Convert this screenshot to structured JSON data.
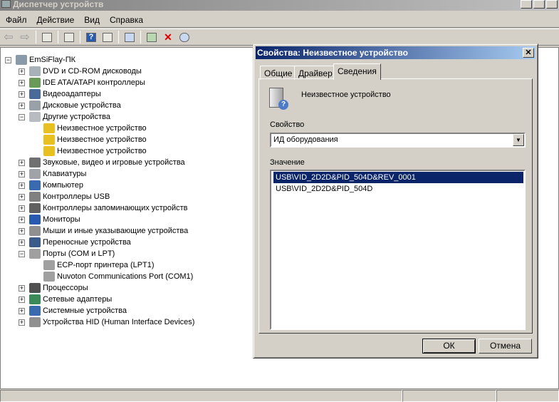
{
  "window": {
    "title": "Диспетчер устройств",
    "min": "_",
    "max": "□",
    "close": "✕"
  },
  "menu": [
    "Файл",
    "Действие",
    "Вид",
    "Справка"
  ],
  "toolbar": [
    "back",
    "forward",
    "show-hide",
    "properties",
    "help",
    "action-pane",
    "scan",
    "update-driver",
    "uninstall",
    "disable"
  ],
  "tree": [
    {
      "level": 0,
      "label": "EmSiFlay-ПК",
      "exp": "−",
      "icon": "computer-icon",
      "color": "#8a9aa8"
    },
    {
      "level": 1,
      "label": "DVD и CD-ROM дисководы",
      "exp": "+",
      "icon": "dvd-icon",
      "color": "#a8b0b8"
    },
    {
      "level": 1,
      "label": "IDE ATA/ATAPI контроллеры",
      "exp": "+",
      "icon": "ide-icon",
      "color": "#6a9a5a"
    },
    {
      "level": 1,
      "label": "Видеоадаптеры",
      "exp": "+",
      "icon": "display-adapter-icon",
      "color": "#4a6a9a"
    },
    {
      "level": 1,
      "label": "Дисковые устройства",
      "exp": "+",
      "icon": "disk-icon",
      "color": "#9aa0a8"
    },
    {
      "level": 1,
      "label": "Другие устройства",
      "exp": "−",
      "icon": "unknown-device-icon",
      "color": "#b8bcc0"
    },
    {
      "level": 2,
      "label": "Неизвестное устройство",
      "icon": "warning-device-icon",
      "color": "#e8c020"
    },
    {
      "level": 2,
      "label": "Неизвестное устройство",
      "icon": "warning-device-icon",
      "color": "#e8c020"
    },
    {
      "level": 2,
      "label": "Неизвестное устройство",
      "icon": "warning-device-icon",
      "color": "#e8c020"
    },
    {
      "level": 1,
      "label": "Звуковые, видео и игровые устройства",
      "exp": "+",
      "icon": "speaker-icon",
      "color": "#707070"
    },
    {
      "level": 1,
      "label": "Клавиатуры",
      "exp": "+",
      "icon": "keyboard-icon",
      "color": "#a0a4a8"
    },
    {
      "level": 1,
      "label": "Компьютер",
      "exp": "+",
      "icon": "computer-icon",
      "color": "#3a6ab0"
    },
    {
      "level": 1,
      "label": "Контроллеры USB",
      "exp": "+",
      "icon": "usb-icon",
      "color": "#808080"
    },
    {
      "level": 1,
      "label": "Контроллеры запоминающих устройств",
      "exp": "+",
      "icon": "storage-controller-icon",
      "color": "#606060"
    },
    {
      "level": 1,
      "label": "Мониторы",
      "exp": "+",
      "icon": "monitor-icon",
      "color": "#2a5ab0"
    },
    {
      "level": 1,
      "label": "Мыши и иные указывающие устройства",
      "exp": "+",
      "icon": "mouse-icon",
      "color": "#909090"
    },
    {
      "level": 1,
      "label": "Переносные устройства",
      "exp": "+",
      "icon": "portable-device-icon",
      "color": "#3a5a8a"
    },
    {
      "level": 1,
      "label": "Порты (COM и LPT)",
      "exp": "−",
      "icon": "port-icon",
      "color": "#a0a0a0"
    },
    {
      "level": 2,
      "label": "ECP-порт принтера (LPT1)",
      "icon": "port-icon",
      "color": "#a0a0a0"
    },
    {
      "level": 2,
      "label": "Nuvoton Communications Port (COM1)",
      "icon": "port-icon",
      "color": "#a0a0a0"
    },
    {
      "level": 1,
      "label": "Процессоры",
      "exp": "+",
      "icon": "processor-icon",
      "color": "#505050"
    },
    {
      "level": 1,
      "label": "Сетевые адаптеры",
      "exp": "+",
      "icon": "network-adapter-icon",
      "color": "#3a8a5a"
    },
    {
      "level": 1,
      "label": "Системные устройства",
      "exp": "+",
      "icon": "system-device-icon",
      "color": "#3a6ab0"
    },
    {
      "level": 1,
      "label": "Устройства HID (Human Interface Devices)",
      "exp": "+",
      "icon": "hid-icon",
      "color": "#909090"
    }
  ],
  "dialog": {
    "title": "Свойства: Неизвестное устройство",
    "close": "✕",
    "tabs": [
      "Общие",
      "Драйвер",
      "Сведения"
    ],
    "active_tab": "Сведения",
    "device_name": "Неизвестное устройство",
    "property_label": "Свойство",
    "property_value": "ИД оборудования",
    "value_label": "Значение",
    "values": [
      "USB\\VID_2D2D&PID_504D&REV_0001",
      "USB\\VID_2D2D&PID_504D"
    ],
    "selected_index": 0,
    "ok": "ОК",
    "cancel": "Отмена"
  }
}
